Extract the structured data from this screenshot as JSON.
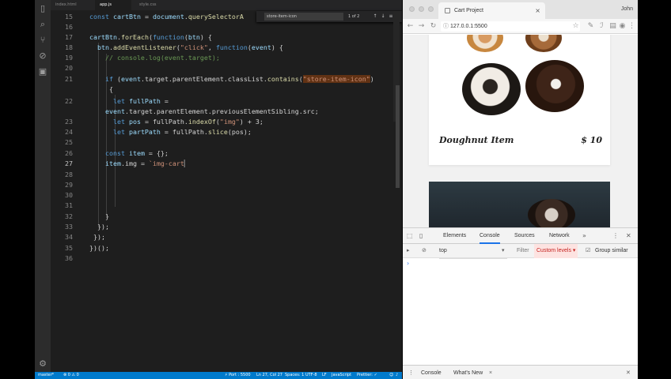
{
  "vscode": {
    "tabs": [
      "index.html",
      "app.js",
      "style.css"
    ],
    "find_widget": {
      "query": "store-item-icon",
      "count": "1 of 2"
    },
    "line_numbers": [
      "15",
      "16",
      "17",
      "18",
      "19",
      "20",
      "21",
      "",
      "22",
      "",
      "23",
      "24",
      "25",
      "26",
      "27",
      "28",
      "29",
      "30",
      "31",
      "32",
      "33",
      "34",
      "35",
      "36"
    ],
    "current_line": "27",
    "statusbar": {
      "branch": "master*",
      "problems": "⊗ 0 ⚠ 0",
      "port": "⚡ Port : 5500",
      "position": "Ln 27, Col 27",
      "spaces": "Spaces: 1",
      "encoding": "UTF-8",
      "eol": "LF",
      "language": "JavaScript",
      "formatter": "Prettier: ✓"
    }
  },
  "chrome": {
    "tab_title": "Cart Project",
    "profile": "John",
    "url": "127.0.0.1:5500",
    "product": {
      "name": "Doughnut Item",
      "price": "$ 10"
    },
    "devtools": {
      "tabs": [
        "Elements",
        "Console",
        "Sources",
        "Network"
      ],
      "active_tab": "Console",
      "context": "top",
      "filter_placeholder": "Filter",
      "levels": "Custom levels ▾",
      "group_similar": "Group similar",
      "prompt": "›",
      "drawer_tabs": [
        "Console",
        "What's New"
      ]
    }
  },
  "colors": {
    "editor_bg": "#1e1e1e",
    "statusbar": "#007acc",
    "keyword": "#569cd6",
    "string": "#ce9178",
    "comment": "#6a9955",
    "function": "#dcdcaa"
  }
}
